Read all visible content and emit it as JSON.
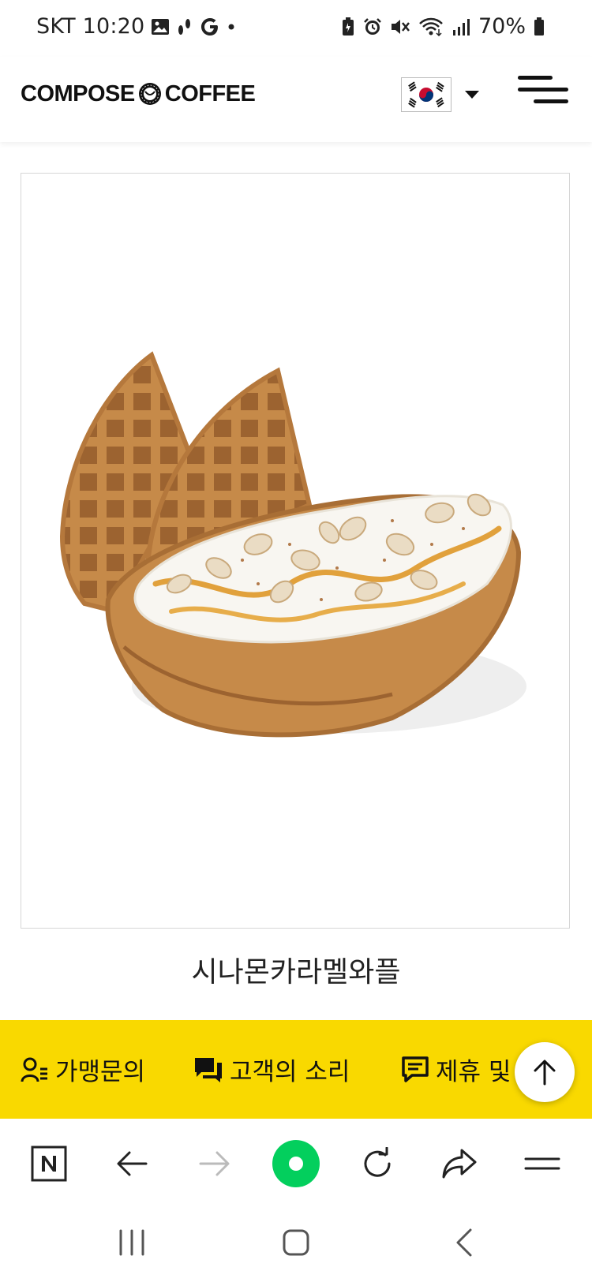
{
  "status_bar": {
    "carrier_time": "SKT 10:20",
    "battery": "70%",
    "left_icons": [
      "gallery-icon",
      "walk-icon",
      "google-g-icon",
      "dot-icon"
    ],
    "right_icons": [
      "battery-saver-icon",
      "alarm-icon",
      "mute-icon",
      "wifi-icon",
      "signal-icon",
      "battery-icon"
    ]
  },
  "header": {
    "logo_left": "COMPOSE",
    "logo_right": "COFFEE",
    "logo_mark_text": "COMPOSE COFFEE",
    "language_flag": "korea-flag-icon"
  },
  "product": {
    "image": "cinnamon-caramel-waffle-photo",
    "name": "시나몬카라멜와플"
  },
  "footer_links": [
    {
      "label": "가맹문의",
      "icon": "person-list-icon"
    },
    {
      "label": "고객의 소리",
      "icon": "chat-bubbles-icon"
    },
    {
      "label": "제휴 및",
      "icon": "message-square-icon"
    }
  ],
  "browser_toolbar": {
    "items": [
      "naver-home-icon",
      "back-arrow-icon",
      "forward-arrow-icon",
      "green-dot-icon",
      "reload-icon",
      "share-icon",
      "menu-icon"
    ]
  },
  "nav_bar": {
    "items": [
      "recent-apps-icon",
      "home-icon",
      "back-icon"
    ]
  },
  "colors": {
    "brand_yellow": "#f9d900",
    "naver_green": "#03cf5d",
    "text": "#111111"
  }
}
